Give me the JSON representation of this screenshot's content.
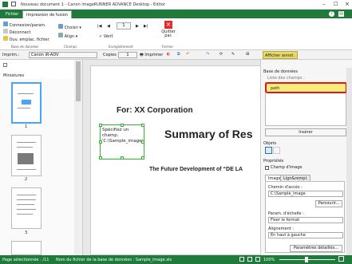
{
  "window": {
    "title": "Nouveau document 1 - Canon imageRUNNER ADVANCE Desktop - Editor"
  },
  "tabs": [
    "Fichier",
    "Impression de fusion"
  ],
  "ribbon": {
    "base_donnees": {
      "label": "Base de données",
      "items": [
        "Connexion/param.",
        "Déconnect",
        "Ouv. emplac. fichier"
      ]
    },
    "champs": {
      "label": "Champs",
      "items": [
        "Choisir",
        "Align"
      ]
    },
    "enregistrement": {
      "label": "Enregistrement",
      "page_value": "1",
      "verif_label": "Vérif."
    }
  },
  "fermer": {
    "label": "Fermer",
    "button": "Quitter\npar."
  },
  "toolbar": {
    "printer_label": "Imprim.:",
    "printer_value": "Canon iR-ADV",
    "copies_label": "Copies",
    "copies_value": "1",
    "print_label": "Imprimer",
    "annot_label": "Afficher annot."
  },
  "thumbnails": {
    "title": "Miniatures",
    "pages": [
      "1",
      "2",
      "3"
    ]
  },
  "document": {
    "heading": "For: XX Corporation",
    "field_text": "Spécifiez un champ.\n'C:\\Sample_image'",
    "title": "Summary of Res",
    "subtitle": "The Future Development of “DE LA"
  },
  "right_panel": {
    "section": "Base de données",
    "list_label": "Liste des champs :",
    "list_item": "path",
    "insert_button": "Insérer",
    "objects_label": "Objets",
    "properties_label": "Propriétés",
    "image_field_label": "Champ d'image",
    "subtabs": [
      "Image",
      "Lign&rempl."
    ],
    "path_label": "Chemin d'accès :",
    "path_value": "C:\\Sample_image",
    "browse_button": "Parcourir...",
    "scale_label": "Param. d'échelle :",
    "scale_value": "Fixer le format",
    "align_label": "Alignement :",
    "align_value": "En haut à gauche",
    "details_button": "Paramètres détaillés..."
  },
  "status": {
    "page": "Page sélectionnée : /11",
    "db_file": "Nom du fichier de la base de données : Sample_image.xls",
    "zoom": "100%"
  }
}
